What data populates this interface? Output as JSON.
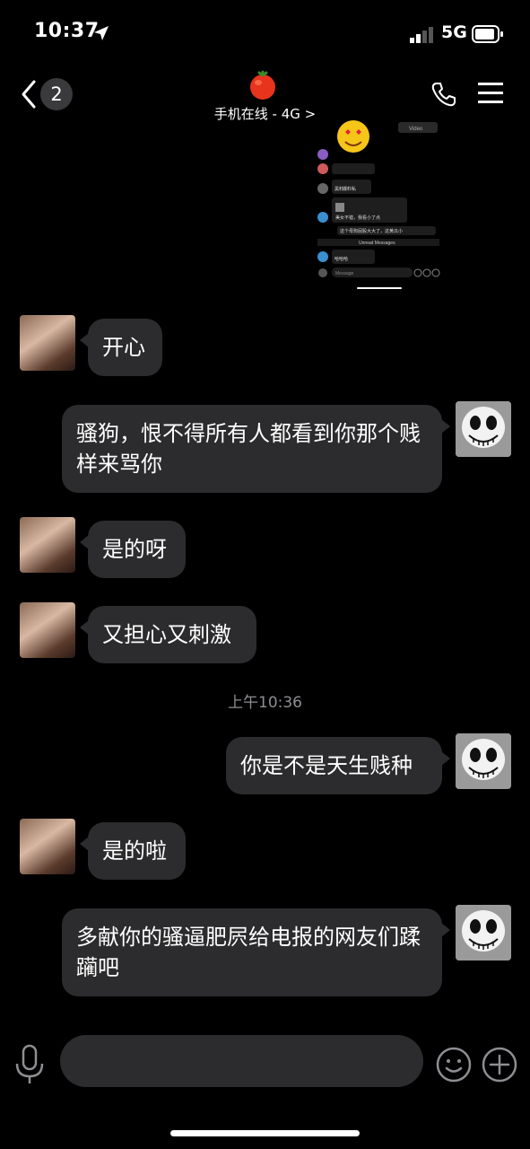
{
  "status_bar": {
    "time": "10:37",
    "network": "5G"
  },
  "header": {
    "unread_count": "2",
    "subtitle": "手机在线 - 4G >"
  },
  "thumbnail": {
    "labels": [
      "Video",
      "Unread Messages",
      "Message",
      "黑料",
      "爆料私",
      "美女不错，我看小了点",
      "这个母狗屁股大大了，这黄瓜小",
      "哈哈哈"
    ]
  },
  "messages": [
    {
      "side": "left",
      "text": "开心"
    },
    {
      "side": "right",
      "text": "骚狗，恨不得所有人都看到你那个贱样来骂你"
    },
    {
      "side": "left",
      "text": "是的呀"
    },
    {
      "side": "left",
      "text": "又担心又刺激"
    },
    {
      "side": "right",
      "text": "你是不是天生贱种"
    },
    {
      "side": "left",
      "text": "是的啦"
    },
    {
      "side": "right",
      "text": "多献你的骚逼肥屄给电报的网友们蹂躏吧"
    }
  ],
  "timestamp": "上午10:36",
  "input": {
    "placeholder": ""
  },
  "colors": {
    "background": "#000000",
    "bubble": "#2c2c2e",
    "timestamp": "#8e8e93"
  }
}
